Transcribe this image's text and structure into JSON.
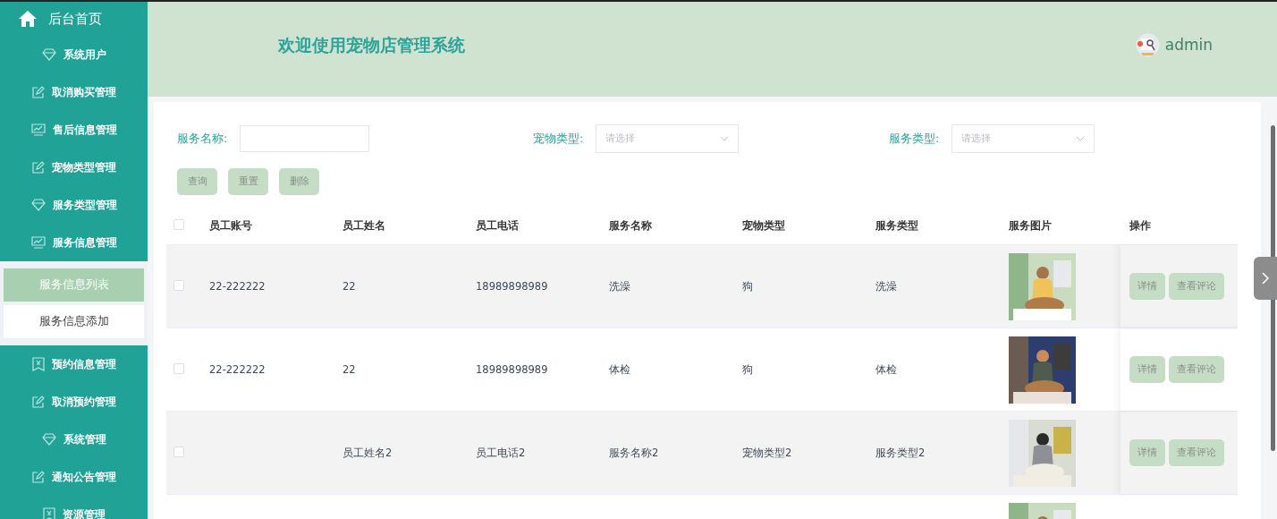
{
  "sidebar": {
    "home": {
      "label": "后台首页"
    },
    "items": [
      {
        "label": "系统用户"
      },
      {
        "label": "取消购买管理"
      },
      {
        "label": "售后信息管理"
      },
      {
        "label": "宠物类型管理"
      },
      {
        "label": "服务类型管理"
      },
      {
        "label": "服务信息管理",
        "children": [
          {
            "label": "服务信息列表",
            "selected": true
          },
          {
            "label": "服务信息添加",
            "selected": false
          }
        ]
      },
      {
        "label": "预约信息管理"
      },
      {
        "label": "取消预约管理"
      },
      {
        "label": "系统管理"
      },
      {
        "label": "通知公告管理"
      },
      {
        "label": "资源管理"
      }
    ]
  },
  "header": {
    "title": "欢迎使用宠物店管理系统",
    "user": "admin"
  },
  "filters": [
    {
      "label": "服务名称:",
      "kind": "input"
    },
    {
      "label": "宠物类型:",
      "kind": "select",
      "placeholder": "请选择"
    },
    {
      "label": "服务类型:",
      "kind": "select",
      "placeholder": "请选择"
    }
  ],
  "buttons": [
    "查询",
    "重置",
    "删除"
  ],
  "table": {
    "select_all": {
      "checked": false
    },
    "columns": [
      "员工账号",
      "员工姓名",
      "员工电话",
      "服务名称",
      "宠物类型",
      "服务类型",
      "服务图片",
      "操作"
    ],
    "rows": [
      {
        "checked": false,
        "cells": [
          "22-222222",
          "22",
          "18989898989",
          "洗澡",
          "狗",
          "洗澡"
        ],
        "image": {
          "kind": "picture"
        },
        "actions": [
          "详情",
          "查看评论"
        ]
      },
      {
        "checked": false,
        "cells": [
          "22-222222",
          "22",
          "18989898989",
          "体检",
          "狗",
          "体检"
        ],
        "image": {
          "kind": "picture"
        },
        "actions": [
          "详情",
          "查看评论"
        ]
      },
      {
        "checked": false,
        "cells": [
          "",
          "员工姓名2",
          "员工电话2",
          "服务名称2",
          "宠物类型2",
          "服务类型2"
        ],
        "image": {
          "kind": "picture"
        },
        "actions": [
          "详情",
          "查看评论"
        ]
      },
      {
        "image": {
          "kind": "picture"
        }
      }
    ]
  }
}
